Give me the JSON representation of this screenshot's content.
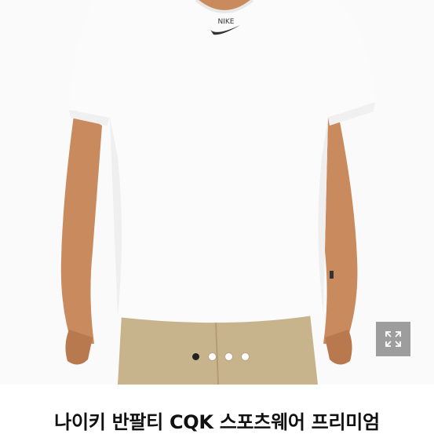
{
  "product": {
    "title": "나이키 반팔티 CQK 스포츠웨어 프리미엄",
    "image_description_icon": "tshirt-photo",
    "logo_text": "NIKE"
  },
  "gallery": {
    "total_images": 4,
    "current_index": 1,
    "expand_icon": "expand-icon"
  },
  "colors": {
    "shirt": "#fbfbfb",
    "skin": "#c98a5e",
    "shorts": "#c8b48c",
    "active_dot": "#222222"
  }
}
